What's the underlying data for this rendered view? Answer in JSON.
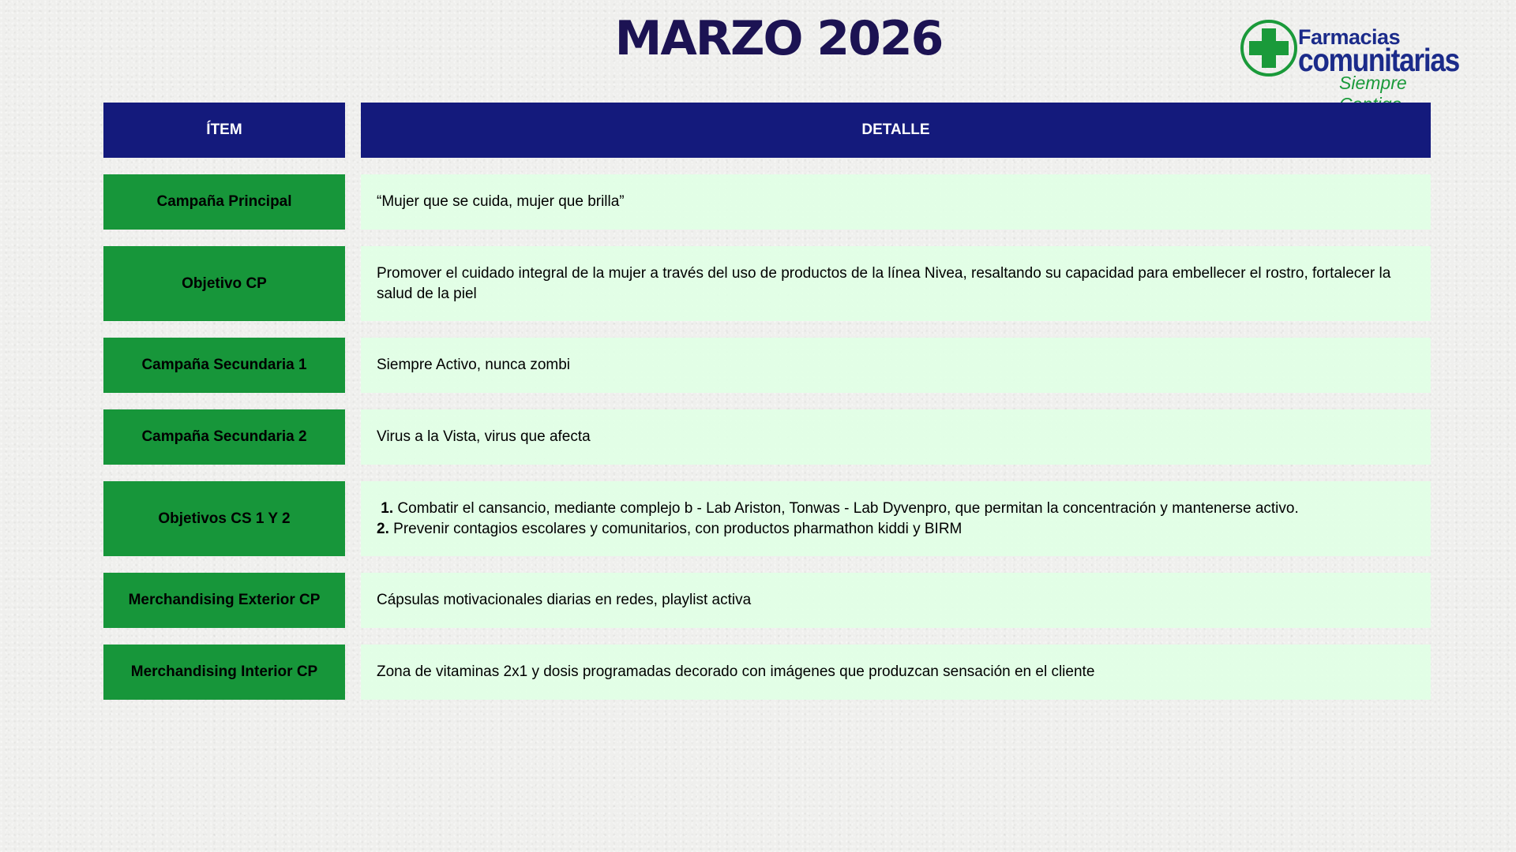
{
  "header": {
    "title": "MARZO 2026"
  },
  "logo": {
    "line1": "Farmacias",
    "line2": "comunitarias",
    "tagline": "Siempre Contigo",
    "colors": {
      "green": "#1a9a3a",
      "blue": "#1b2b8a"
    }
  },
  "table": {
    "headers": {
      "item": "ÍTEM",
      "detail": "DETALLE"
    },
    "rows": [
      {
        "item": "Campaña Principal",
        "detail": "“Mujer que se cuida, mujer que brilla”"
      },
      {
        "item": "Objetivo CP",
        "detail": "Promover el cuidado integral de la mujer a través del uso de productos de la línea Nivea, resaltando su capacidad para embellecer el rostro, fortalecer la salud de la piel"
      },
      {
        "item": "Campaña Secundaria 1",
        "detail": "Siempre Activo, nunca zombi"
      },
      {
        "item": "Campaña Secundaria 2",
        "detail": "Virus a la Vista, virus que afecta"
      },
      {
        "item": "Objetivos CS 1 Y 2",
        "detail_items": [
          {
            "num": "1.",
            "text": "Combatir el cansancio, mediante complejo b - Lab Ariston, Tonwas - Lab Dyvenpro, que permitan la concentración y mantenerse activo."
          },
          {
            "num": "2.",
            "text": "Prevenir contagios escolares y comunitarios, con productos pharmathon kiddi y BIRM"
          }
        ]
      },
      {
        "item": "Merchandising Exterior CP",
        "detail": "Cápsulas motivacionales diarias en redes, playlist activa"
      },
      {
        "item": "Merchandising Interior CP",
        "detail": "Zona de vitaminas 2x1 y dosis programadas decorado con imágenes que produzcan sensación en el cliente"
      }
    ]
  },
  "colors": {
    "header_bg": "#141a7c",
    "item_bg": "#17963a",
    "detail_bg": "#e1ffe5",
    "title_color": "#1c1353"
  }
}
